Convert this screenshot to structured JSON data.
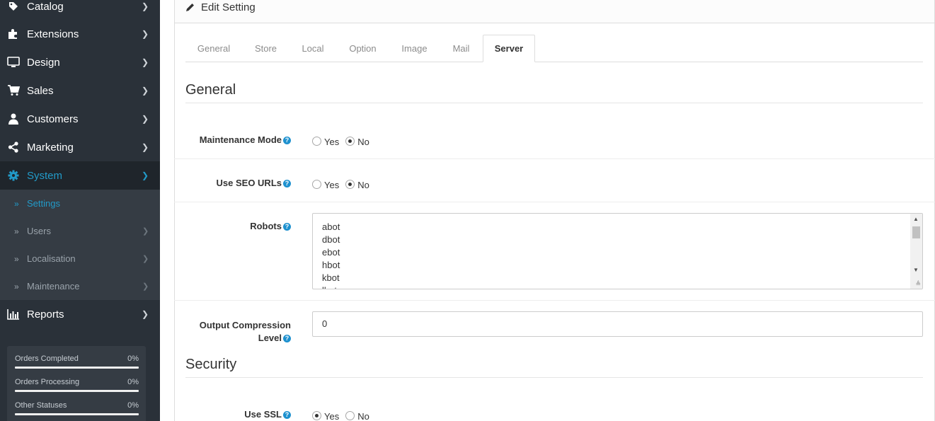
{
  "sidebar": {
    "menu": [
      {
        "label": "Catalog",
        "icon": "tag-icon"
      },
      {
        "label": "Extensions",
        "icon": "puzzle-icon"
      },
      {
        "label": "Design",
        "icon": "desktop-icon"
      },
      {
        "label": "Sales",
        "icon": "cart-icon"
      },
      {
        "label": "Customers",
        "icon": "user-icon"
      },
      {
        "label": "Marketing",
        "icon": "share-icon"
      },
      {
        "label": "System",
        "icon": "gear-icon"
      },
      {
        "label": "Reports",
        "icon": "bar-chart-icon"
      }
    ],
    "system_submenu": [
      {
        "label": "Settings"
      },
      {
        "label": "Users"
      },
      {
        "label": "Localisation"
      },
      {
        "label": "Maintenance"
      }
    ],
    "stats": [
      {
        "label": "Orders Completed",
        "value": "0%",
        "progress": 0
      },
      {
        "label": "Orders Processing",
        "value": "0%",
        "progress": 0
      },
      {
        "label": "Other Statuses",
        "value": "0%",
        "progress": 0
      }
    ]
  },
  "panel": {
    "title": "Edit Setting",
    "title_icon": "pencil-icon"
  },
  "tabs": [
    "General",
    "Store",
    "Local",
    "Option",
    "Image",
    "Mail",
    "Server"
  ],
  "active_tab": "Server",
  "sections": {
    "general": "General",
    "security": "Security"
  },
  "fields": {
    "maintenance_mode": {
      "label": "Maintenance Mode",
      "yes": "Yes",
      "no": "No",
      "selected": "No"
    },
    "seo_urls": {
      "label": "Use SEO URLs",
      "yes": "Yes",
      "no": "No",
      "selected": "No"
    },
    "robots": {
      "label": "Robots",
      "lines": [
        "abot",
        "dbot",
        "ebot",
        "hbot",
        "kbot",
        "lbot"
      ]
    },
    "compression": {
      "label_line1": "Output Compression",
      "label_line2": "Level",
      "value": "0"
    },
    "use_ssl": {
      "label": "Use SSL",
      "yes": "Yes",
      "no": "No",
      "selected": "Yes"
    }
  },
  "colors": {
    "sidebar_bg": "#2a3139",
    "accent": "#229ac8",
    "help_icon": "#1e91cf"
  }
}
